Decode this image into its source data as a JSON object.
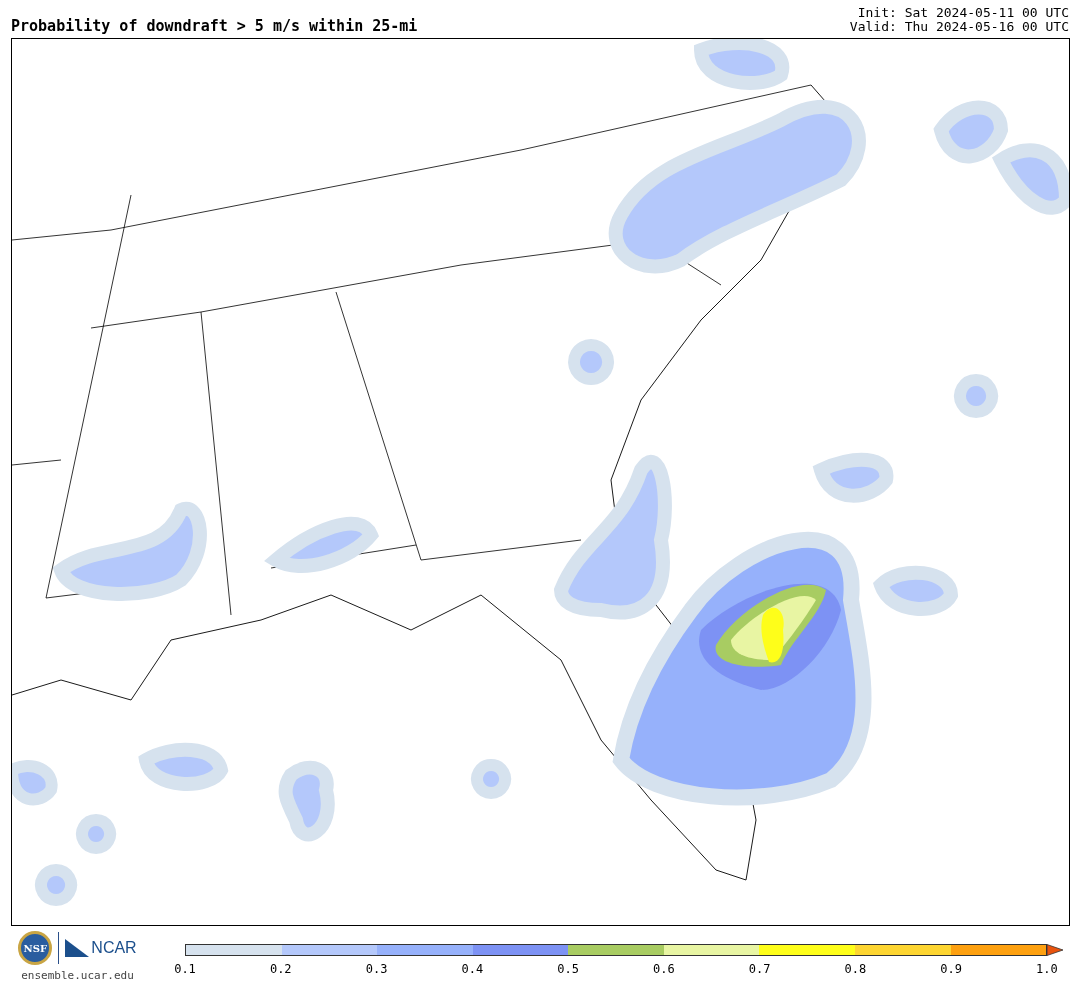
{
  "title": "Probability of downdraft > 5 m/s within 25-mi",
  "init": "Init: Sat 2024-05-11 00 UTC",
  "valid": "Valid: Thu 2024-05-16 00 UTC",
  "footer": {
    "nsf_logo": "NSF",
    "ncar_logo": "NCAR",
    "url": "ensemble.ucar.edu"
  },
  "colorbar": {
    "bins": [
      {
        "color": "#d6e2ee"
      },
      {
        "color": "#b4c8fb"
      },
      {
        "color": "#96b1fb"
      },
      {
        "color": "#7d92f4"
      },
      {
        "color": "#a8cc62"
      },
      {
        "color": "#e8f5a3"
      },
      {
        "color": "#fefe1a"
      },
      {
        "color": "#fdd531"
      },
      {
        "color": "#fda010"
      }
    ],
    "labels": [
      "0.1",
      "0.2",
      "0.3",
      "0.4",
      "0.5",
      "0.6",
      "0.7",
      "0.8",
      "0.9",
      "1.0"
    ]
  }
}
